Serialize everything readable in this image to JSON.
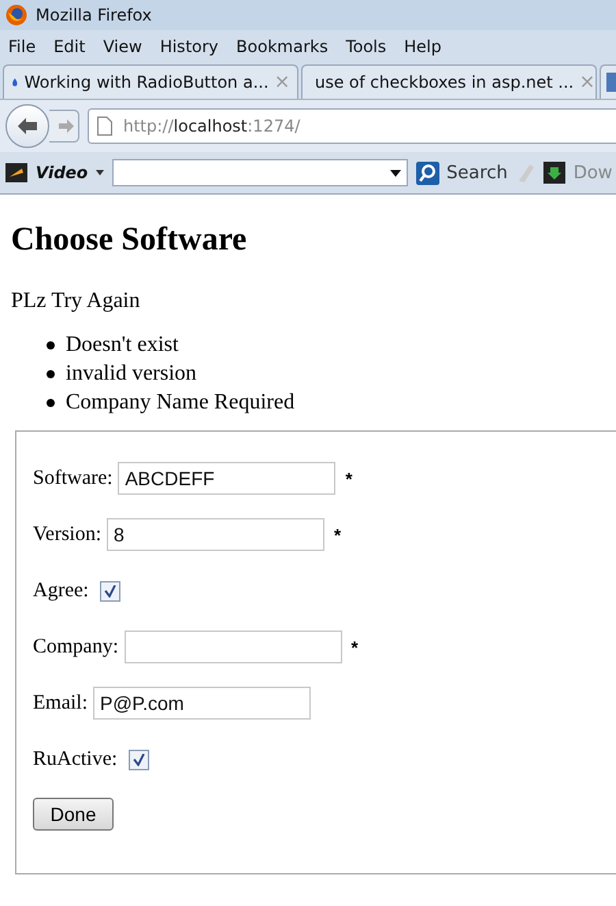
{
  "window": {
    "title": "Mozilla Firefox"
  },
  "menu": [
    "File",
    "Edit",
    "View",
    "History",
    "Bookmarks",
    "Tools",
    "Help"
  ],
  "tabs": [
    {
      "label": "Working with RadioButton a...",
      "selected": false,
      "close": "×"
    },
    {
      "label": "use of checkboxes in asp.net ...",
      "selected": false,
      "close": "×"
    }
  ],
  "address": {
    "prefix": "http://",
    "host": "localhost",
    "suffix": ":1274/"
  },
  "toolbar": {
    "video": "Video",
    "search_button": "Search",
    "download": "Dow"
  },
  "page": {
    "heading": "Choose Software",
    "message": "PLz Try Again",
    "errors": [
      "Doesn't exist",
      "invalid version",
      "Company Name Required"
    ],
    "fields": [
      {
        "kind": "text",
        "label": "Software:",
        "value": "ABCDEFF",
        "required": true
      },
      {
        "kind": "text",
        "label": "Version:",
        "value": "8",
        "required": true
      },
      {
        "kind": "checkbox",
        "label": "Agree:",
        "checked": true
      },
      {
        "kind": "text",
        "label": "Company:",
        "required": true
      },
      {
        "kind": "text",
        "label": "Email:",
        "value": "P@P.com",
        "required": false
      },
      {
        "kind": "checkbox",
        "label": "RuActive:",
        "checked": true
      }
    ],
    "required_mark": "*",
    "submit": "Done"
  }
}
